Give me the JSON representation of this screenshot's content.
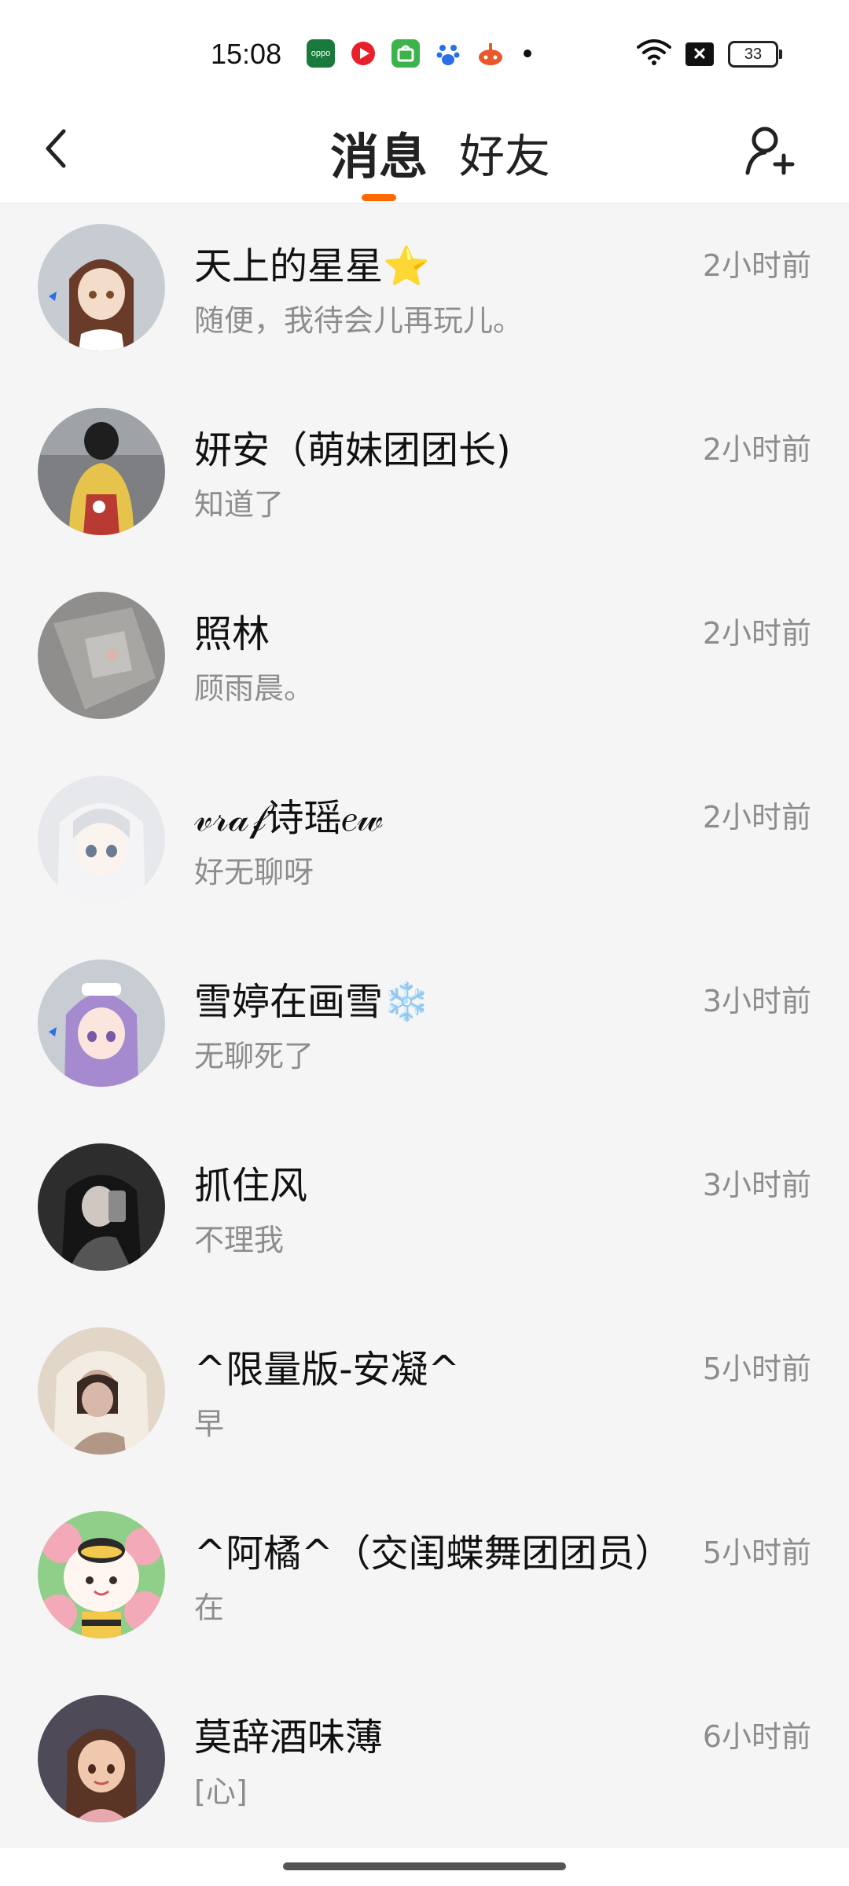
{
  "status_bar": {
    "time": "15:08",
    "battery": "33",
    "apps": [
      {
        "icon": "oppo-app-icon",
        "color": "#1a7a3c",
        "label": "oppo"
      },
      {
        "icon": "video-app-icon",
        "color": "#e8202a",
        "label": ""
      },
      {
        "icon": "shopping-app-icon",
        "color": "#3cb44b",
        "label": ""
      },
      {
        "icon": "baidu-app-icon",
        "color": "#2a6ee8",
        "label": ""
      },
      {
        "icon": "game-app-icon",
        "color": "#e8582a",
        "label": ""
      }
    ]
  },
  "header": {
    "tabs": [
      {
        "label": "消息",
        "active": true
      },
      {
        "label": "好友",
        "active": false
      }
    ],
    "accent_color": "#ff6a00"
  },
  "conversations": [
    {
      "name": "天上的星星⭐",
      "message": "随便，我待会儿再玩儿。",
      "time": "2小时前",
      "avatar_color": "#c9b7a8"
    },
    {
      "name": "妍安（萌妹团团长)",
      "message": "知道了",
      "time": "2小时前",
      "avatar_color": "#b8483e"
    },
    {
      "name": "照林",
      "message": "顾雨晨。",
      "time": "2小时前",
      "avatar_color": "#8f8f8f"
    },
    {
      "name": "𝓋𝓇𝒶𝒻诗瑶𝑒𝓌",
      "message": "好无聊呀",
      "time": "2小时前",
      "avatar_color": "#d8dae0"
    },
    {
      "name": "雪婷在画雪❄️",
      "message": "无聊死了",
      "time": "3小时前",
      "avatar_color": "#b99ad6"
    },
    {
      "name": "抓住风",
      "message": "不理我",
      "time": "3小时前",
      "avatar_color": "#3a3a3a"
    },
    {
      "name": "^限量版-安凝^",
      "message": "早",
      "time": "5小时前",
      "avatar_color": "#d8c6b4"
    },
    {
      "name": "^阿橘^（交闺蝶舞团团员）",
      "message": "在",
      "time": "5小时前",
      "avatar_color": "#f3c8cf"
    },
    {
      "name": "莫辞酒味薄",
      "message": "[心]",
      "time": "6小时前",
      "avatar_color": "#5a4a4a"
    }
  ]
}
